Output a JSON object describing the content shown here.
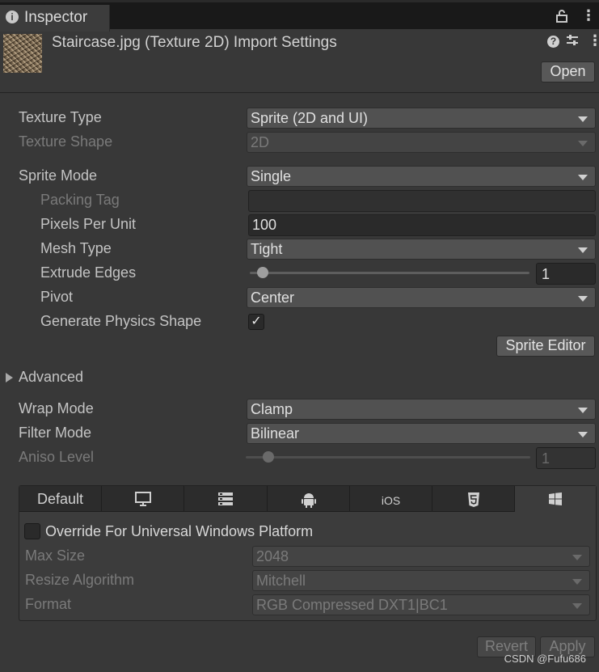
{
  "tab": {
    "title": "Inspector"
  },
  "header": {
    "title": "Staircase.jpg (Texture 2D) Import Settings",
    "open_label": "Open"
  },
  "fields": {
    "texture_type": {
      "label": "Texture Type",
      "value": "Sprite (2D and UI)"
    },
    "texture_shape": {
      "label": "Texture Shape",
      "value": "2D"
    },
    "sprite_mode": {
      "label": "Sprite Mode",
      "value": "Single"
    },
    "packing_tag": {
      "label": "Packing Tag",
      "value": ""
    },
    "pixels_per_unit": {
      "label": "Pixels Per Unit",
      "value": "100"
    },
    "mesh_type": {
      "label": "Mesh Type",
      "value": "Tight"
    },
    "extrude_edges": {
      "label": "Extrude Edges",
      "value": "1",
      "slider_fraction": 0.0
    },
    "pivot": {
      "label": "Pivot",
      "value": "Center"
    },
    "generate_physics_shape": {
      "label": "Generate Physics Shape",
      "checked": true,
      "check_glyph": "✓"
    },
    "sprite_editor_label": "Sprite Editor",
    "advanced_label": "Advanced",
    "wrap_mode": {
      "label": "Wrap Mode",
      "value": "Clamp"
    },
    "filter_mode": {
      "label": "Filter Mode",
      "value": "Bilinear"
    },
    "aniso_level": {
      "label": "Aniso Level",
      "value": "1",
      "slider_fraction": 0.0
    }
  },
  "platforms": {
    "tabs": [
      {
        "label": "Default",
        "icon": ""
      },
      {
        "label": "",
        "icon": "monitor-icon"
      },
      {
        "label": "",
        "icon": "server-icon"
      },
      {
        "label": "",
        "icon": "android-icon"
      },
      {
        "label": "iOS",
        "icon": ""
      },
      {
        "label": "",
        "icon": "html5-icon"
      },
      {
        "label": "",
        "icon": "windows-icon"
      }
    ],
    "active_tab": 6,
    "override_label": "Override For Universal Windows Platform",
    "override_checked": false,
    "max_size": {
      "label": "Max Size",
      "value": "2048"
    },
    "resize_algorithm": {
      "label": "Resize Algorithm",
      "value": "Mitchell"
    },
    "format": {
      "label": "Format",
      "value": "RGB Compressed DXT1|BC1"
    }
  },
  "footer": {
    "revert_label": "Revert",
    "apply_label": "Apply",
    "watermark": "CSDN @Fufu686"
  }
}
